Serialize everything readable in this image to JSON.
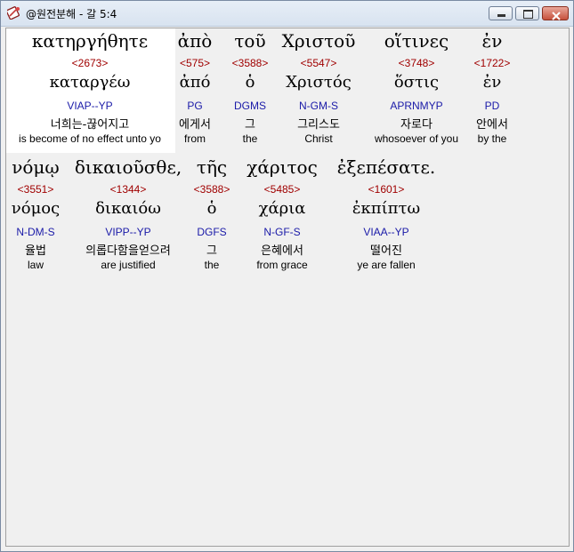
{
  "window": {
    "title": "@원전분해 - 갈 5:4",
    "icon": "bible-app-icon",
    "controls": [
      "minimize-icon",
      "maximize-icon",
      "close-icon"
    ]
  },
  "colors": {
    "strong_number": "#a00000",
    "morphology": "#1a1aa8",
    "highlight_background": "#ffffff",
    "window_background": "#f0f0f0"
  },
  "words": [
    {
      "greek": "κατηργήθητε",
      "strong": "<2673>",
      "lemma": "καταργέω",
      "morph": "VIAP--YP",
      "korean": "너희는-끊어지고",
      "english": "is become of no effect unto yo",
      "selected": true
    },
    {
      "greek": "ἀπὸ",
      "strong": "<575>",
      "lemma": "ἀπό",
      "morph": "PG",
      "korean": "에게서",
      "english": "from",
      "selected": false
    },
    {
      "greek": "τοῦ",
      "strong": "<3588>",
      "lemma": "ὁ",
      "morph": "DGMS",
      "korean": "그",
      "english": "the",
      "selected": false
    },
    {
      "greek": "Χριστοῦ",
      "strong": "<5547>",
      "lemma": "Χριστός",
      "morph": "N-GM-S",
      "korean": "그리스도",
      "english": "Christ",
      "selected": false
    },
    {
      "greek": "οἵτινες",
      "strong": "<3748>",
      "lemma": "ὅστις",
      "morph": "APRNMYP",
      "korean": "자로다",
      "english": "whosoever of you",
      "selected": false
    },
    {
      "greek": "ἐν",
      "strong": "<1722>",
      "lemma": "ἐν",
      "morph": "PD",
      "korean": "안에서",
      "english": "by the",
      "selected": false
    },
    {
      "greek": "νόμῳ",
      "strong": "<3551>",
      "lemma": "νόμος",
      "morph": "N-DM-S",
      "korean": "율법",
      "english": "law",
      "selected": false
    },
    {
      "greek": "δικαιοῦσθε,",
      "strong": "<1344>",
      "lemma": "δικαιόω",
      "morph": "VIPP--YP",
      "korean": "의롭다함을얻으려",
      "english": "are justified",
      "selected": false
    },
    {
      "greek": "τῆς",
      "strong": "<3588>",
      "lemma": "ὁ",
      "morph": "DGFS",
      "korean": "그",
      "english": "the",
      "selected": false
    },
    {
      "greek": "χάριτος",
      "strong": "<5485>",
      "lemma": "χάρια",
      "morph": "N-GF-S",
      "korean": "은혜에서",
      "english": "from grace",
      "selected": false
    },
    {
      "greek": "ἐξεπέσατε.",
      "strong": "<1601>",
      "lemma": "ἐκπίπτω",
      "morph": "VIAA--YP",
      "korean": "떨어진",
      "english": "ye are fallen",
      "selected": false
    }
  ]
}
